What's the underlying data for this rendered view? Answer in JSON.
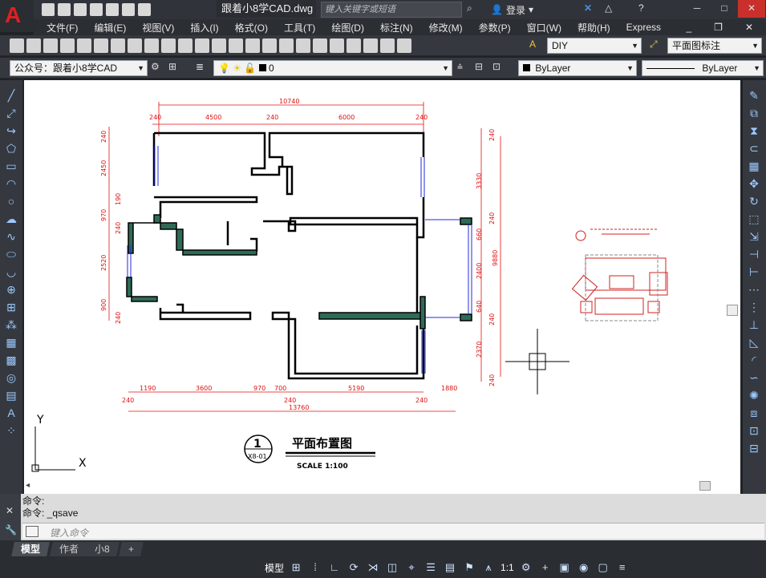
{
  "title_bar": {
    "document_title": "跟着小8学CAD.dwg",
    "search_placeholder": "键入关键字或短语",
    "login_label": "登录"
  },
  "menu": {
    "items": [
      "文件(F)",
      "编辑(E)",
      "视图(V)",
      "插入(I)",
      "格式(O)",
      "工具(T)",
      "绘图(D)",
      "标注(N)",
      "修改(M)",
      "参数(P)",
      "窗口(W)",
      "帮助(H)",
      "Express"
    ]
  },
  "toolbar1": {
    "text_style": "DIY",
    "dim_style": "平面图标注"
  },
  "toolbar2": {
    "workspace": "公众号：跟着小8学CAD",
    "layer": "0",
    "color": "ByLayer",
    "linetype": "ByLayer"
  },
  "drawing": {
    "top_dims": [
      "10740",
      "240",
      "4500",
      "240",
      "6000",
      "240"
    ],
    "bottom_dims": [
      "1190",
      "3600",
      "970",
      "700",
      "5190",
      "1880",
      "240",
      "240",
      "240",
      "13760"
    ],
    "left_dims": [
      "240",
      "2450",
      "190",
      "970",
      "240",
      "2520",
      "900",
      "240"
    ],
    "right_dims": [
      "240",
      "3330",
      "240",
      "660",
      "9880",
      "2400",
      "640",
      "240",
      "2370",
      "240"
    ],
    "title": "平面布置图",
    "title_number": "1",
    "title_ref": "X8-01",
    "scale": "SCALE 1:100",
    "ucs_x": "X",
    "ucs_y": "Y"
  },
  "command": {
    "history": [
      "命令:",
      "命令: _qsave"
    ],
    "placeholder": "键入命令"
  },
  "tabs": [
    "模型",
    "作者",
    "小8"
  ],
  "status": {
    "model_label": "模型",
    "scale_label": "1:1"
  },
  "colors": {
    "dim_red": "#e01010",
    "wall_black": "#000000",
    "column_green": "#2e6b56",
    "window_blue": "#1f2bd6"
  }
}
